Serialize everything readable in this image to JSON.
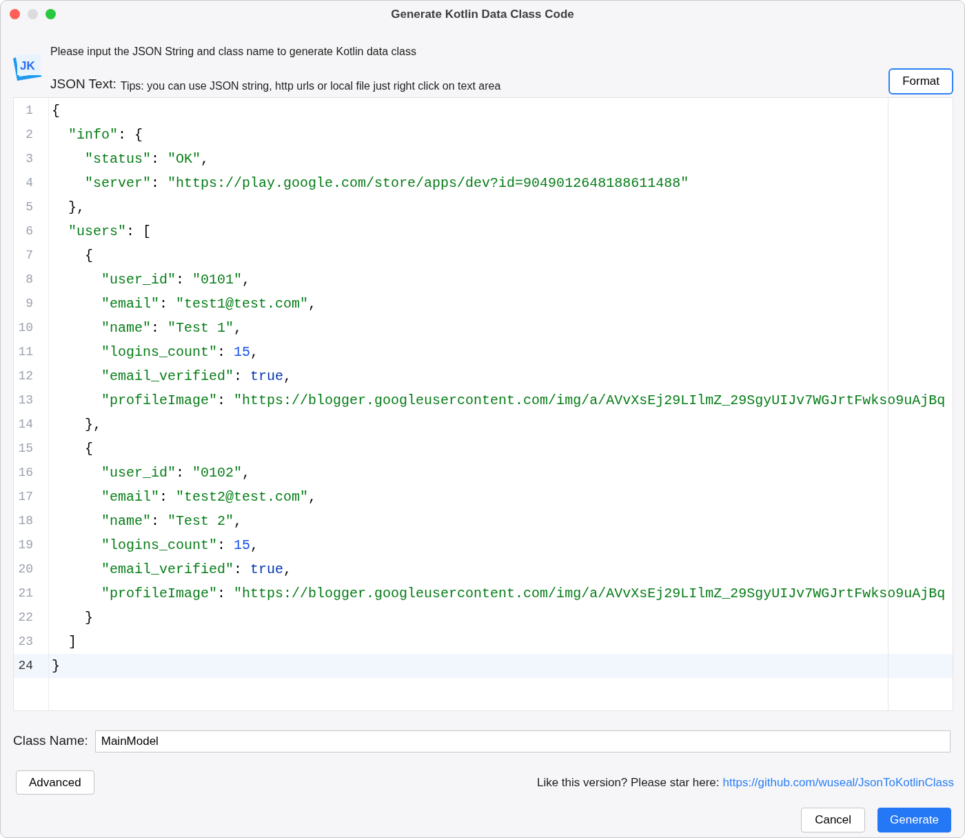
{
  "window": {
    "title": "Generate Kotlin Data Class Code"
  },
  "header": {
    "logo_text": "JK",
    "description": "Please input the JSON String and class name to generate Kotlin data class",
    "json_label": "JSON Text:",
    "tips": "Tips: you can use JSON string, http urls or local file just right click on text area",
    "format_button": "Format"
  },
  "editor": {
    "lines": [
      {
        "number": "1",
        "current": false,
        "tokens": [
          {
            "kind": "punct",
            "text": "{"
          }
        ],
        "children": [
          {
            "number": "2",
            "current": false,
            "tokens": [
              {
                "kind": "key",
                "text": "\"info\""
              },
              {
                "kind": "punct",
                "text": ": {"
              }
            ],
            "children": [
              {
                "number": "3",
                "current": false,
                "tokens": [
                  {
                    "kind": "key",
                    "text": "\"status\""
                  },
                  {
                    "kind": "punct",
                    "text": ": "
                  },
                  {
                    "kind": "string",
                    "text": "\"OK\""
                  },
                  {
                    "kind": "punct",
                    "text": ","
                  }
                ]
              },
              {
                "number": "4",
                "current": false,
                "tokens": [
                  {
                    "kind": "key",
                    "text": "\"server\""
                  },
                  {
                    "kind": "punct",
                    "text": ": "
                  },
                  {
                    "kind": "string",
                    "text": "\"https://play.google.com/store/apps/dev?id=9049012648188611488\""
                  }
                ]
              }
            ]
          },
          {
            "number": "5",
            "current": false,
            "tokens": [
              {
                "kind": "punct",
                "text": "},"
              }
            ]
          },
          {
            "number": "6",
            "current": false,
            "tokens": [
              {
                "kind": "key",
                "text": "\"users\""
              },
              {
                "kind": "punct",
                "text": ": ["
              }
            ],
            "children": [
              {
                "number": "7",
                "current": false,
                "tokens": [
                  {
                    "kind": "punct",
                    "text": "{"
                  }
                ],
                "children": [
                  {
                    "number": "8",
                    "current": false,
                    "tokens": [
                      {
                        "kind": "key",
                        "text": "\"user_id\""
                      },
                      {
                        "kind": "punct",
                        "text": ": "
                      },
                      {
                        "kind": "string",
                        "text": "\"0101\""
                      },
                      {
                        "kind": "punct",
                        "text": ","
                      }
                    ]
                  },
                  {
                    "number": "9",
                    "current": false,
                    "tokens": [
                      {
                        "kind": "key",
                        "text": "\"email\""
                      },
                      {
                        "kind": "punct",
                        "text": ": "
                      },
                      {
                        "kind": "string",
                        "text": "\"test1@test.com\""
                      },
                      {
                        "kind": "punct",
                        "text": ","
                      }
                    ]
                  },
                  {
                    "number": "10",
                    "current": false,
                    "tokens": [
                      {
                        "kind": "key",
                        "text": "\"name\""
                      },
                      {
                        "kind": "punct",
                        "text": ": "
                      },
                      {
                        "kind": "string",
                        "text": "\"Test 1\""
                      },
                      {
                        "kind": "punct",
                        "text": ","
                      }
                    ]
                  },
                  {
                    "number": "11",
                    "current": false,
                    "tokens": [
                      {
                        "kind": "key",
                        "text": "\"logins_count\""
                      },
                      {
                        "kind": "punct",
                        "text": ": "
                      },
                      {
                        "kind": "number",
                        "text": "15"
                      },
                      {
                        "kind": "punct",
                        "text": ","
                      }
                    ]
                  },
                  {
                    "number": "12",
                    "current": false,
                    "tokens": [
                      {
                        "kind": "key",
                        "text": "\"email_verified\""
                      },
                      {
                        "kind": "punct",
                        "text": ": "
                      },
                      {
                        "kind": "bool",
                        "text": "true"
                      },
                      {
                        "kind": "punct",
                        "text": ","
                      }
                    ]
                  },
                  {
                    "number": "13",
                    "current": false,
                    "tokens": [
                      {
                        "kind": "key",
                        "text": "\"profileImage\""
                      },
                      {
                        "kind": "punct",
                        "text": ": "
                      },
                      {
                        "kind": "string",
                        "text": "\"https://blogger.googleusercontent.com/img/a/AVvXsEj29LIlmZ_29SgyUIJv7WGJrtFwkso9uAjBq"
                      }
                    ]
                  }
                ]
              },
              {
                "number": "14",
                "current": false,
                "tokens": [
                  {
                    "kind": "punct",
                    "text": "},"
                  }
                ]
              },
              {
                "number": "15",
                "current": false,
                "tokens": [
                  {
                    "kind": "punct",
                    "text": "{"
                  }
                ],
                "children": [
                  {
                    "number": "16",
                    "current": false,
                    "tokens": [
                      {
                        "kind": "key",
                        "text": "\"user_id\""
                      },
                      {
                        "kind": "punct",
                        "text": ": "
                      },
                      {
                        "kind": "string",
                        "text": "\"0102\""
                      },
                      {
                        "kind": "punct",
                        "text": ","
                      }
                    ]
                  },
                  {
                    "number": "17",
                    "current": false,
                    "tokens": [
                      {
                        "kind": "key",
                        "text": "\"email\""
                      },
                      {
                        "kind": "punct",
                        "text": ": "
                      },
                      {
                        "kind": "string",
                        "text": "\"test2@test.com\""
                      },
                      {
                        "kind": "punct",
                        "text": ","
                      }
                    ]
                  },
                  {
                    "number": "18",
                    "current": false,
                    "tokens": [
                      {
                        "kind": "key",
                        "text": "\"name\""
                      },
                      {
                        "kind": "punct",
                        "text": ": "
                      },
                      {
                        "kind": "string",
                        "text": "\"Test 2\""
                      },
                      {
                        "kind": "punct",
                        "text": ","
                      }
                    ]
                  },
                  {
                    "number": "19",
                    "current": false,
                    "tokens": [
                      {
                        "kind": "key",
                        "text": "\"logins_count\""
                      },
                      {
                        "kind": "punct",
                        "text": ": "
                      },
                      {
                        "kind": "number",
                        "text": "15"
                      },
                      {
                        "kind": "punct",
                        "text": ","
                      }
                    ]
                  },
                  {
                    "number": "20",
                    "current": false,
                    "tokens": [
                      {
                        "kind": "key",
                        "text": "\"email_verified\""
                      },
                      {
                        "kind": "punct",
                        "text": ": "
                      },
                      {
                        "kind": "bool",
                        "text": "true"
                      },
                      {
                        "kind": "punct",
                        "text": ","
                      }
                    ]
                  },
                  {
                    "number": "21",
                    "current": false,
                    "tokens": [
                      {
                        "kind": "key",
                        "text": "\"profileImage\""
                      },
                      {
                        "kind": "punct",
                        "text": ": "
                      },
                      {
                        "kind": "string",
                        "text": "\"https://blogger.googleusercontent.com/img/a/AVvXsEj29LIlmZ_29SgyUIJv7WGJrtFwkso9uAjBq"
                      }
                    ]
                  }
                ]
              },
              {
                "number": "22",
                "current": false,
                "tokens": [
                  {
                    "kind": "punct",
                    "text": "}"
                  }
                ]
              }
            ]
          },
          {
            "number": "23",
            "current": false,
            "tokens": [
              {
                "kind": "punct",
                "text": "]"
              }
            ]
          }
        ]
      },
      {
        "number": "24",
        "current": true,
        "tokens": [
          {
            "kind": "punct",
            "text": "}"
          }
        ]
      }
    ]
  },
  "class_name": {
    "label": "Class Name:",
    "value": "MainModel"
  },
  "footer": {
    "advanced_button": "Advanced",
    "star_text": "Like this version? Please star here:",
    "star_link": "https://github.com/wuseal/JsonToKotlinClass",
    "cancel_button": "Cancel",
    "generate_button": "Generate"
  }
}
